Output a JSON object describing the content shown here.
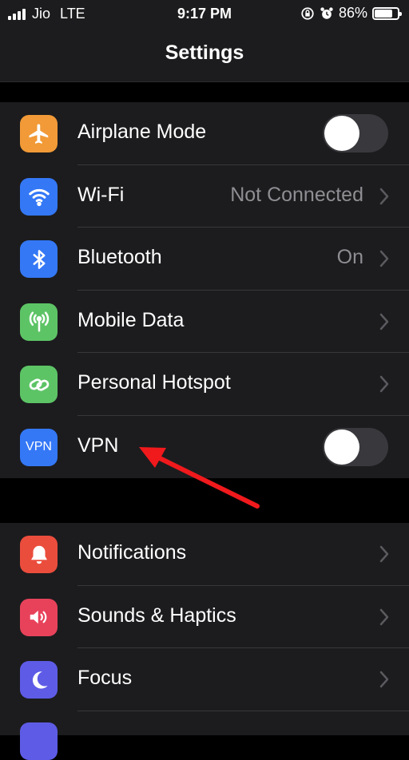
{
  "status_bar": {
    "carrier": "Jio",
    "network": "LTE",
    "time": "9:17 PM",
    "battery": "86%",
    "battery_level": 0.86
  },
  "header": {
    "title": "Settings"
  },
  "group1": [
    {
      "label": "Airplane Mode",
      "icon": "airplane-icon",
      "color": "#f19a37",
      "control": "toggle",
      "on": false
    },
    {
      "label": "Wi-Fi",
      "icon": "wifi-icon",
      "color": "#3478f6",
      "value": "Not Connected",
      "control": "chevron"
    },
    {
      "label": "Bluetooth",
      "icon": "bluetooth-icon",
      "color": "#3478f6",
      "value": "On",
      "control": "chevron"
    },
    {
      "label": "Mobile Data",
      "icon": "antenna-icon",
      "color": "#5dc466",
      "control": "chevron"
    },
    {
      "label": "Personal Hotspot",
      "icon": "hotspot-icon",
      "color": "#5dc466",
      "control": "chevron"
    },
    {
      "label": "VPN",
      "icon": "vpn-icon",
      "icon_text": "VPN",
      "color": "#3478f6",
      "control": "toggle",
      "on": false
    }
  ],
  "group2": [
    {
      "label": "Notifications",
      "icon": "bell-icon",
      "color": "#eb4d3d",
      "control": "chevron"
    },
    {
      "label": "Sounds & Haptics",
      "icon": "speaker-icon",
      "color": "#e8425b",
      "control": "chevron"
    },
    {
      "label": "Focus",
      "icon": "moon-icon",
      "color": "#5e5ce6",
      "control": "chevron"
    }
  ],
  "annotation_color": "#f0191c"
}
